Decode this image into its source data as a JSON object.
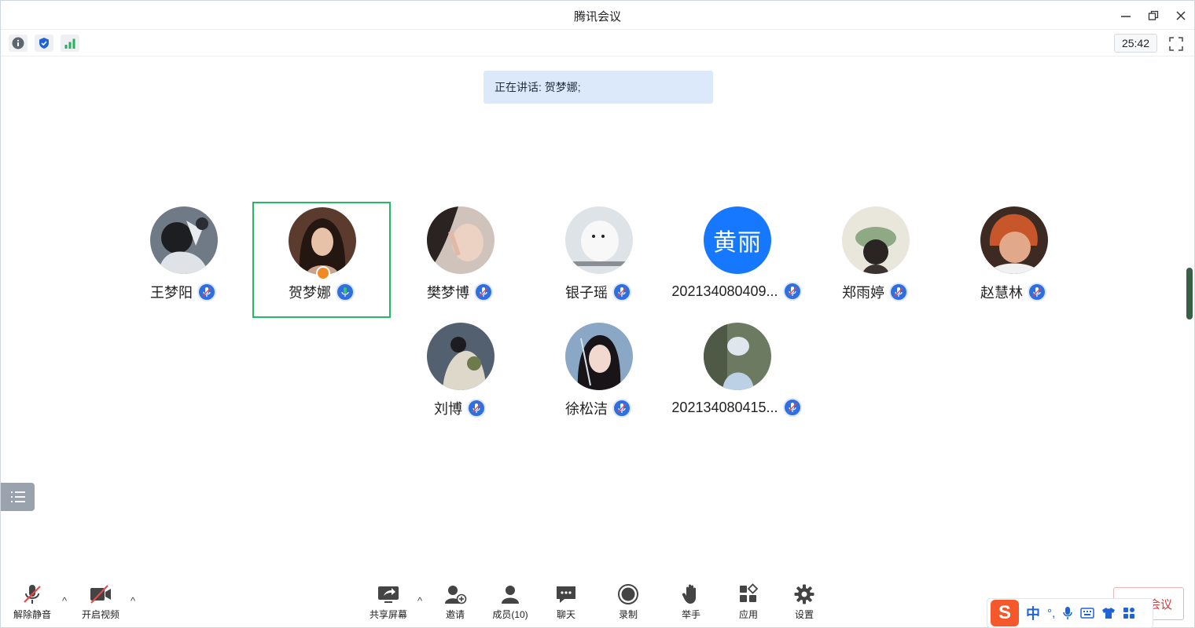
{
  "app": {
    "title": "腾讯会议"
  },
  "infobar": {
    "timer": "25:42"
  },
  "speaking": {
    "text": "正在讲话: 贺梦娜;"
  },
  "participants": [
    {
      "name": "王梦阳",
      "mic": "muted"
    },
    {
      "name": "贺梦娜",
      "mic": "speaking",
      "host": true,
      "active": true
    },
    {
      "name": "樊梦博",
      "mic": "muted"
    },
    {
      "name": "银子瑶",
      "mic": "muted"
    },
    {
      "name": "202134080409...",
      "mic": "muted",
      "avatar_text": "黄丽"
    },
    {
      "name": "郑雨婷",
      "mic": "muted"
    },
    {
      "name": "赵慧林",
      "mic": "muted"
    },
    {
      "name": "刘博",
      "mic": "muted"
    },
    {
      "name": "徐松洁",
      "mic": "muted"
    },
    {
      "name": "202134080415...",
      "mic": "muted"
    }
  ],
  "toolbar": {
    "unmute": "解除静音",
    "video": "开启视频",
    "share": "共享屏幕",
    "invite": "邀请",
    "members": "成员(10)",
    "chat": "聊天",
    "record": "录制",
    "raise_hand": "举手",
    "apps": "应用",
    "settings": "设置",
    "leave": "离开会议"
  },
  "ime": {
    "lang": "中",
    "punct": "°,"
  },
  "colors": {
    "active_border": "#25b865",
    "mic_blue": "#2f6fe0",
    "speaking_bg": "#dce9fb",
    "leave_red": "#d83a3a"
  }
}
